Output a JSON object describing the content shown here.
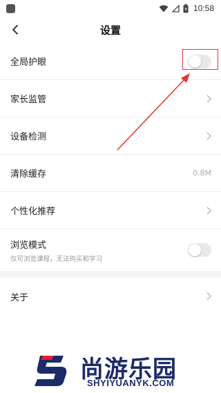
{
  "status_bar": {
    "time": "10:58"
  },
  "header": {
    "title": "设置"
  },
  "settings": {
    "global_eye_care": {
      "label": "全局护眼",
      "enabled": false
    },
    "parental_control": {
      "label": "家长监管"
    },
    "device_check": {
      "label": "设备检测"
    },
    "clear_cache": {
      "label": "清除缓存",
      "value": "0.8M"
    },
    "personalized_recommend": {
      "label": "个性化推荐"
    },
    "browse_mode": {
      "label": "浏览模式",
      "sublabel": "仅可浏览课程，无法购买和学习",
      "enabled": false
    },
    "about": {
      "label": "关于"
    }
  },
  "watermark": {
    "brand_cn": "尚游乐园",
    "brand_en": "SHYIYUANYK.COM"
  },
  "colors": {
    "annotation_red": "#e53935",
    "toggle_off": "#e9e9ec",
    "brand_navy": "#1c2a68",
    "brand_red": "#e0232f"
  }
}
